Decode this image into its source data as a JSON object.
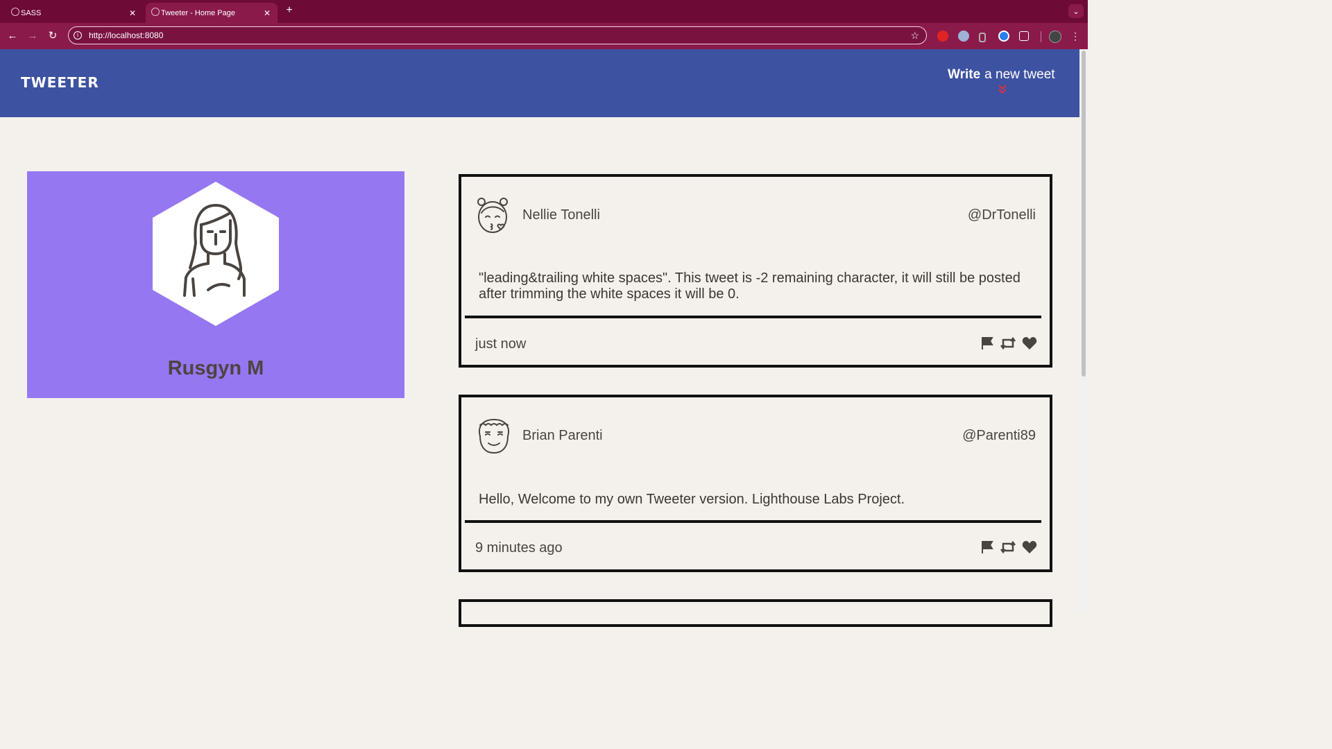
{
  "browser": {
    "tabs": [
      {
        "label": "SASS",
        "active": false
      },
      {
        "label": "Tweeter - Home Page",
        "active": true
      }
    ],
    "url": "http://localhost:8080"
  },
  "header": {
    "brand": "TWEETER",
    "compose_bold": "Write",
    "compose_rest": "a new tweet"
  },
  "profile": {
    "name": "Rusgyn M"
  },
  "tweets": [
    {
      "author": "Nellie Tonelli",
      "handle": "@DrTonelli",
      "body": "\"leading&trailing white spaces\". This tweet is -2 remaining character, it will still be posted after trimming the white spaces it will be 0.",
      "age": "just now"
    },
    {
      "author": "Brian Parenti",
      "handle": "@Parenti89",
      "body": "Hello, Welcome to my own Tweeter version. Lighthouse Labs Project.",
      "age": "9 minutes ago"
    }
  ],
  "icons": {
    "flag": "flag-icon",
    "retweet": "retweet-icon",
    "like": "heart-icon"
  },
  "colors": {
    "header_bg": "#3d52a0",
    "profile_bg": "#9577f2",
    "page_bg": "#f4f1ec",
    "browser_frame": "#6e0a36"
  }
}
